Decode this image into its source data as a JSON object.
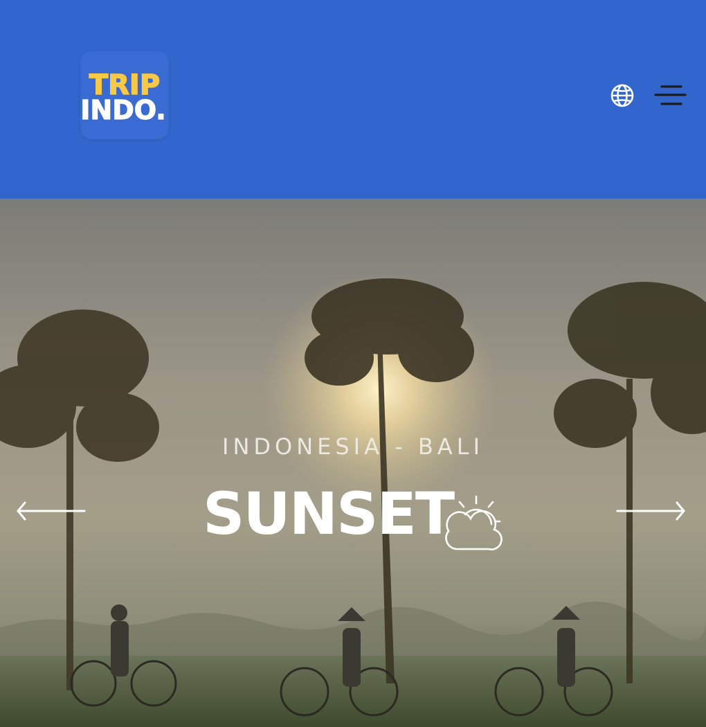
{
  "header": {
    "logo": {
      "line1": "TRIP",
      "line2": "INDO.",
      "colors": {
        "line1": "#f7c946",
        "line2": "#ffffff"
      }
    },
    "icons": {
      "language": "globe-icon",
      "menu": "hamburger-menu-icon"
    },
    "background_color": "#3366cc"
  },
  "hero": {
    "subtitle": "INDONESIA - BALI",
    "title": "SUNSET",
    "weather_icon": "partly-cloudy-icon",
    "prev_icon": "arrow-left-icon",
    "next_icon": "arrow-right-icon",
    "image": "cyclists-in-rice-field-at-sunset"
  }
}
